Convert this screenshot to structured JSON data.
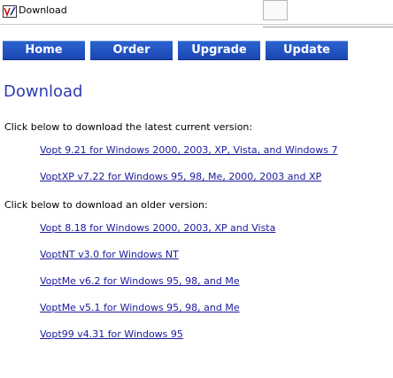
{
  "window": {
    "title": "Download"
  },
  "nav": {
    "items": [
      {
        "label": "Home"
      },
      {
        "label": "Order"
      },
      {
        "label": "Upgrade"
      },
      {
        "label": "Update"
      }
    ]
  },
  "main": {
    "heading": "Download",
    "latest_label": "Click below to download the latest current version:",
    "latest_links": [
      {
        "text": "Vopt 9.21 for Windows 2000, 2003, XP, Vista, and Windows 7"
      },
      {
        "text": "VoptXP v7.22 for Windows 95, 98, Me, 2000, 2003 and XP"
      }
    ],
    "older_label": "Click below to download an older version:",
    "older_links": [
      {
        "text": "Vopt 8.18 for Windows 2000, 2003, XP and Vista"
      },
      {
        "text": "VoptNT v3.0 for Windows NT"
      },
      {
        "text": "VoptMe v6.2 for Windows 95, 98, and Me"
      },
      {
        "text": "VoptMe v5.1 for Windows 95, 98, and Me"
      },
      {
        "text": "Vopt99 v4.31 for Windows 95"
      }
    ]
  },
  "colors": {
    "nav_button": "#1f4fc0",
    "heading": "#2c3db2",
    "link": "#1a1a9c"
  }
}
